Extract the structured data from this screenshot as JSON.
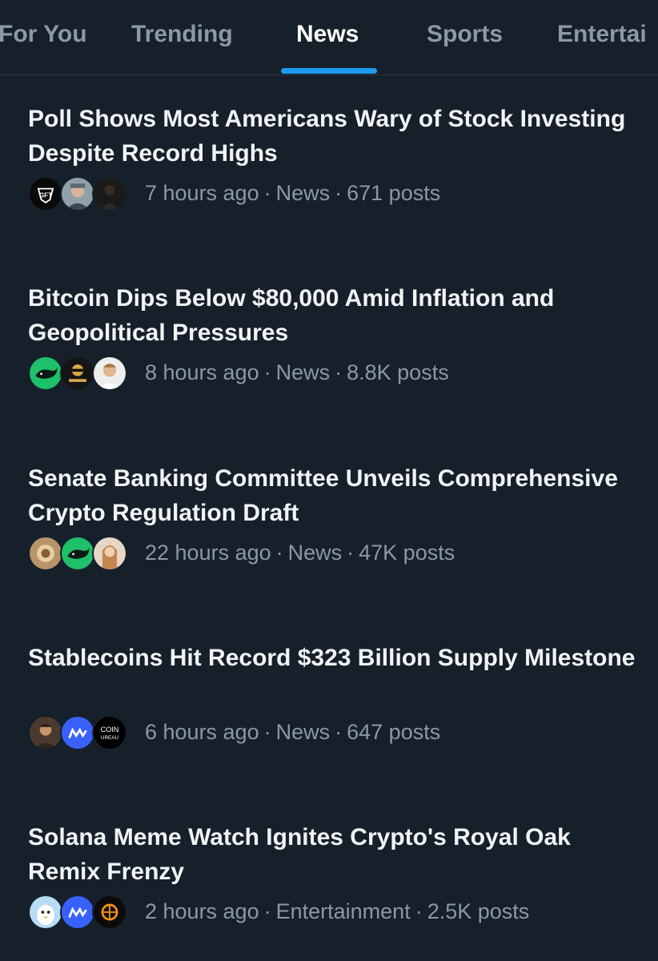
{
  "tabs": [
    {
      "label": "For You"
    },
    {
      "label": "Trending"
    },
    {
      "label": "News",
      "active": true
    },
    {
      "label": "Sports"
    },
    {
      "label": "Entertai"
    }
  ],
  "stories": [
    {
      "headline": "Poll Shows Most Americans Wary of Stock Investing Despite Record Highs",
      "time": "7 hours ago",
      "category": "News",
      "posts": "671 posts",
      "avatars": [
        "gft-logo-avatar",
        "person-avatar",
        "person-dark-avatar"
      ]
    },
    {
      "headline": "Bitcoin Dips Below $80,000 Amid Inflation and Geopolitical Pressures",
      "time": "8 hours ago",
      "category": "News",
      "posts": "8.8K posts",
      "avatars": [
        "whale-green-avatar",
        "cartoon-avatar",
        "person-avatar"
      ]
    },
    {
      "headline": "Senate Banking Committee Unveils Comprehensive Crypto Regulation Draft",
      "time": "22 hours ago",
      "category": "News",
      "posts": "47K posts",
      "avatars": [
        "gold-logo-avatar",
        "whale-green-avatar",
        "person-avatar"
      ]
    },
    {
      "headline": "Stablecoins Hit Record $323 Billion Supply Milestone",
      "time": "6 hours ago",
      "category": "News",
      "posts": "647 posts",
      "avatars": [
        "person-avatar",
        "coinmarketcap-avatar",
        "coin-bureau-avatar"
      ]
    },
    {
      "headline": "Solana Meme Watch Ignites Crypto's Royal Oak Remix Frenzy",
      "time": "2 hours ago",
      "category": "Entertainment",
      "posts": "2.5K posts",
      "avatars": [
        "penguin-avatar",
        "coinmarketcap-avatar",
        "dark-logo-avatar"
      ]
    }
  ],
  "avatar_text": {
    "gft": "GFT",
    "coin_bureau_line1": "COIN",
    "coin_bureau_line2": "UREAU"
  },
  "colors": {
    "background": "#16202b",
    "accent": "#1d9bf0",
    "muted_text": "#8b98a5",
    "headline_text": "#f1f3f4"
  }
}
